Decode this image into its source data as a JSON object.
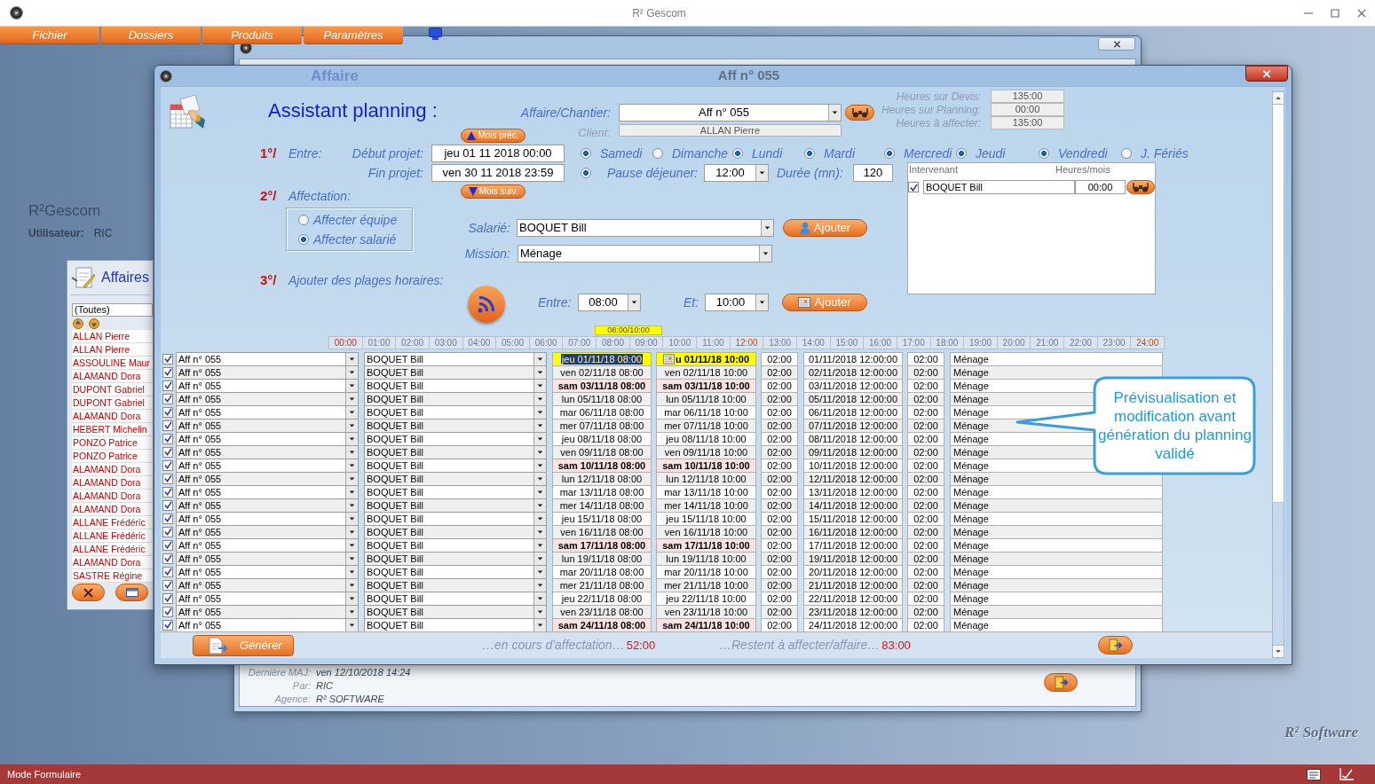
{
  "window": {
    "title": "R² Gescom"
  },
  "menu": [
    {
      "label": "Fichier"
    },
    {
      "label": "Dossiers"
    },
    {
      "label": "Produits"
    },
    {
      "label": "Paramètres"
    }
  ],
  "desktop": {
    "brand": "R²Gescom",
    "user_label": "Utilisateur:",
    "user": "RIC",
    "logo": "R² Software"
  },
  "affaires_window": {
    "title": "Affaires",
    "filter": "(Toutes)",
    "items": [
      "ALLAN Pierre",
      "ALLAN Pierre",
      "ASSOULINE Maur",
      "ALAMAND Dora",
      "DUPONT Gabriel",
      "DUPONT Gabriel",
      "ALAMAND Dora",
      "HEBERT Michelin",
      "PONZO Patrice",
      "PONZO Patrice",
      "ALAMAND Dora",
      "ALAMAND Dora",
      "ALAMAND Dora",
      "ALAMAND Dora",
      "ALLANE Frédéric",
      "ALLANE Frédéric",
      "ALLANE Frédéric",
      "ALAMAND Dora",
      "SASTRE Régine"
    ]
  },
  "affaire_window": {
    "footer": [
      {
        "label": "Dernière MAJ:",
        "value": "ven 12/10/2018 14:24"
      },
      {
        "label": "Par:",
        "value": "RIC"
      },
      {
        "label": "Agence:",
        "value": "R² SOFTWARE"
      }
    ]
  },
  "planning_dialog": {
    "title_bar": {
      "ghost": "Affaire",
      "title": "Aff n° 055"
    },
    "heading": "Assistant planning :",
    "affaire": {
      "label": "Affaire/Chantier:",
      "value": "Aff n° 055"
    },
    "client": {
      "label": "Client:",
      "value": "ALLAN Pierre"
    },
    "hours": [
      {
        "label": "Heures sur Devis:",
        "value": "135:00"
      },
      {
        "label": "Heures sur Planning:",
        "value": "00:00"
      },
      {
        "label": "Heures à affecter:",
        "value": "135:00"
      }
    ],
    "prev_month": "Mois préc.",
    "next_month": "Mois suiv.",
    "period": {
      "step": "1°/",
      "label": "Entre:",
      "start_label": "Début projet:",
      "start": "jeu 01 11 2018 00:00",
      "end_label": "Fin projet:",
      "end": "ven 30 11 2018 23:59"
    },
    "days": [
      {
        "label": "Samedi",
        "checked": true
      },
      {
        "label": "Dimanche",
        "checked": false
      },
      {
        "label": "Lundi",
        "checked": true
      },
      {
        "label": "Mardi",
        "checked": true
      },
      {
        "label": "Mercredi",
        "checked": true
      },
      {
        "label": "Jeudi",
        "checked": true
      },
      {
        "label": "Vendredi",
        "checked": true
      },
      {
        "label": "J. Fériés",
        "checked": false
      }
    ],
    "lunch": {
      "checked": true,
      "label": "Pause déjeuner:",
      "value": "12:00"
    },
    "duration": {
      "label": "Durée (mn):",
      "value": "120"
    },
    "assignment": {
      "step": "2°/",
      "label": "Affectation:",
      "options": [
        {
          "label": "Affecter équipe",
          "selected": false
        },
        {
          "label": "Affecter salarié",
          "selected": true
        }
      ]
    },
    "employee": {
      "label": "Salarié:",
      "value": "BOQUET Bill",
      "button": "Ajouter"
    },
    "mission": {
      "label": "Mission:",
      "value": "Ménage"
    },
    "workers": {
      "columns": [
        "Intervenant",
        "Heures/mois"
      ],
      "rows": [
        {
          "checked": true,
          "name": "BOQUET Bill",
          "hours": "00:00"
        }
      ]
    },
    "slots": {
      "step": "3°/",
      "label": "Ajouter des plages horaires:",
      "from_label": "Entre:",
      "from": "08:00",
      "to_label": "Et:",
      "to": "10:00",
      "button": "Ajouter"
    },
    "timeline": {
      "range": "08:00/10:00",
      "hours": [
        {
          "label": "00:00",
          "kind": "red"
        },
        {
          "label": "01:00",
          "kind": "plain"
        },
        {
          "label": "02:00",
          "kind": "plain"
        },
        {
          "label": "03:00",
          "kind": "plain"
        },
        {
          "label": "04:00",
          "kind": "plain"
        },
        {
          "label": "05:00",
          "kind": "plain"
        },
        {
          "label": "06:00",
          "kind": "plain"
        },
        {
          "label": "07:00",
          "kind": "plain"
        },
        {
          "label": "08:00",
          "kind": "plain"
        },
        {
          "label": "09:00",
          "kind": "plain"
        },
        {
          "label": "10:00",
          "kind": "plain"
        },
        {
          "label": "11:00",
          "kind": "plain"
        },
        {
          "label": "12:00",
          "kind": "orange"
        },
        {
          "label": "13:00",
          "kind": "plain"
        },
        {
          "label": "14:00",
          "kind": "plain"
        },
        {
          "label": "15:00",
          "kind": "plain"
        },
        {
          "label": "16:00",
          "kind": "plain"
        },
        {
          "label": "17:00",
          "kind": "plain"
        },
        {
          "label": "18:00",
          "kind": "plain"
        },
        {
          "label": "19:00",
          "kind": "plain"
        },
        {
          "label": "20:00",
          "kind": "plain"
        },
        {
          "label": "21:00",
          "kind": "plain"
        },
        {
          "label": "22:00",
          "kind": "plain"
        },
        {
          "label": "23:00",
          "kind": "plain"
        },
        {
          "label": "24:00",
          "kind": "orange"
        }
      ]
    },
    "rows": [
      {
        "checked": true,
        "selected": true,
        "weekend": false,
        "cells": [
          "Aff n° 055",
          "BOQUET Bill",
          "jeu 01/11/18 08:00",
          "u 01/11/18 10:00",
          "02:00",
          "01/11/2018 12:00:00",
          "02:00",
          "Ménage"
        ]
      },
      {
        "checked": true,
        "selected": false,
        "weekend": false,
        "cells": [
          "Aff n° 055",
          "BOQUET Bill",
          "ven 02/11/18 08:00",
          "ven 02/11/18 10:00",
          "02:00",
          "02/11/2018 12:00:00",
          "02:00",
          "Ménage"
        ]
      },
      {
        "checked": true,
        "selected": false,
        "weekend": true,
        "cells": [
          "Aff n° 055",
          "BOQUET Bill",
          "sam 03/11/18 08:00",
          "sam 03/11/18 10:00",
          "02:00",
          "03/11/2018 12:00:00",
          "02:00",
          "Ménage"
        ]
      },
      {
        "checked": true,
        "selected": false,
        "weekend": false,
        "cells": [
          "Aff n° 055",
          "BOQUET Bill",
          "lun 05/11/18 08:00",
          "lun 05/11/18 10:00",
          "02:00",
          "05/11/2018 12:00:00",
          "02:00",
          "Ménage"
        ]
      },
      {
        "checked": true,
        "selected": false,
        "weekend": false,
        "cells": [
          "Aff n° 055",
          "BOQUET Bill",
          "mar 06/11/18 08:00",
          "mar 06/11/18 10:00",
          "02:00",
          "06/11/2018 12:00:00",
          "02:00",
          "Ménage"
        ]
      },
      {
        "checked": true,
        "selected": false,
        "weekend": false,
        "cells": [
          "Aff n° 055",
          "BOQUET Bill",
          "mer 07/11/18 08:00",
          "mer 07/11/18 10:00",
          "02:00",
          "07/11/2018 12:00:00",
          "02:00",
          "Ménage"
        ]
      },
      {
        "checked": true,
        "selected": false,
        "weekend": false,
        "cells": [
          "Aff n° 055",
          "BOQUET Bill",
          "jeu 08/11/18 08:00",
          "jeu 08/11/18 10:00",
          "02:00",
          "08/11/2018 12:00:00",
          "02:00",
          "Ménage"
        ]
      },
      {
        "checked": true,
        "selected": false,
        "weekend": false,
        "cells": [
          "Aff n° 055",
          "BOQUET Bill",
          "ven 09/11/18 08:00",
          "ven 09/11/18 10:00",
          "02:00",
          "09/11/2018 12:00:00",
          "02:00",
          "Ménage"
        ]
      },
      {
        "checked": true,
        "selected": false,
        "weekend": true,
        "cells": [
          "Aff n° 055",
          "BOQUET Bill",
          "sam 10/11/18 08:00",
          "sam 10/11/18 10:00",
          "02:00",
          "10/11/2018 12:00:00",
          "02:00",
          "Ménage"
        ]
      },
      {
        "checked": true,
        "selected": false,
        "weekend": false,
        "cells": [
          "Aff n° 055",
          "BOQUET Bill",
          "lun 12/11/18 08:00",
          "lun 12/11/18 10:00",
          "02:00",
          "12/11/2018 12:00:00",
          "02:00",
          "Ménage"
        ]
      },
      {
        "checked": true,
        "selected": false,
        "weekend": false,
        "cells": [
          "Aff n° 055",
          "BOQUET Bill",
          "mar 13/11/18 08:00",
          "mar 13/11/18 10:00",
          "02:00",
          "13/11/2018 12:00:00",
          "02:00",
          "Ménage"
        ]
      },
      {
        "checked": true,
        "selected": false,
        "weekend": false,
        "cells": [
          "Aff n° 055",
          "BOQUET Bill",
          "mer 14/11/18 08:00",
          "mer 14/11/18 10:00",
          "02:00",
          "14/11/2018 12:00:00",
          "02:00",
          "Ménage"
        ]
      },
      {
        "checked": true,
        "selected": false,
        "weekend": false,
        "cells": [
          "Aff n° 055",
          "BOQUET Bill",
          "jeu 15/11/18 08:00",
          "jeu 15/11/18 10:00",
          "02:00",
          "15/11/2018 12:00:00",
          "02:00",
          "Ménage"
        ]
      },
      {
        "checked": true,
        "selected": false,
        "weekend": false,
        "cells": [
          "Aff n° 055",
          "BOQUET Bill",
          "ven 16/11/18 08:00",
          "ven 16/11/18 10:00",
          "02:00",
          "16/11/2018 12:00:00",
          "02:00",
          "Ménage"
        ]
      },
      {
        "checked": true,
        "selected": false,
        "weekend": true,
        "cells": [
          "Aff n° 055",
          "BOQUET Bill",
          "sam 17/11/18 08:00",
          "sam 17/11/18 10:00",
          "02:00",
          "17/11/2018 12:00:00",
          "02:00",
          "Ménage"
        ]
      },
      {
        "checked": true,
        "selected": false,
        "weekend": false,
        "cells": [
          "Aff n° 055",
          "BOQUET Bill",
          "lun 19/11/18 08:00",
          "lun 19/11/18 10:00",
          "02:00",
          "19/11/2018 12:00:00",
          "02:00",
          "Ménage"
        ]
      },
      {
        "checked": true,
        "selected": false,
        "weekend": false,
        "cells": [
          "Aff n° 055",
          "BOQUET Bill",
          "mar 20/11/18 08:00",
          "mar 20/11/18 10:00",
          "02:00",
          "20/11/2018 12:00:00",
          "02:00",
          "Ménage"
        ]
      },
      {
        "checked": true,
        "selected": false,
        "weekend": false,
        "cells": [
          "Aff n° 055",
          "BOQUET Bill",
          "mer 21/11/18 08:00",
          "mer 21/11/18 10:00",
          "02:00",
          "21/11/2018 12:00:00",
          "02:00",
          "Ménage"
        ]
      },
      {
        "checked": true,
        "selected": false,
        "weekend": false,
        "cells": [
          "Aff n° 055",
          "BOQUET Bill",
          "jeu 22/11/18 08:00",
          "jeu 22/11/18 10:00",
          "02:00",
          "22/11/2018 12:00:00",
          "02:00",
          "Ménage"
        ]
      },
      {
        "checked": true,
        "selected": false,
        "weekend": false,
        "cells": [
          "Aff n° 055",
          "BOQUET Bill",
          "ven 23/11/18 08:00",
          "ven 23/11/18 10:00",
          "02:00",
          "23/11/2018 12:00:00",
          "02:00",
          "Ménage"
        ]
      },
      {
        "checked": true,
        "selected": false,
        "weekend": true,
        "cells": [
          "Aff n° 055",
          "BOQUET Bill",
          "sam 24/11/18 08:00",
          "sam 24/11/18 10:00",
          "02:00",
          "24/11/2018 12:00:00",
          "02:00",
          "Ménage"
        ]
      }
    ],
    "generate": "Générer",
    "totals": [
      {
        "label": "…en cours d'affectation…",
        "value": "52:00"
      },
      {
        "label": "…Restent à affecter/affaire…",
        "value": "83:00"
      }
    ],
    "callout": "Prévisualisation et modification avant génération du planning validé"
  },
  "status_bar": {
    "mode": "Mode Formulaire"
  }
}
